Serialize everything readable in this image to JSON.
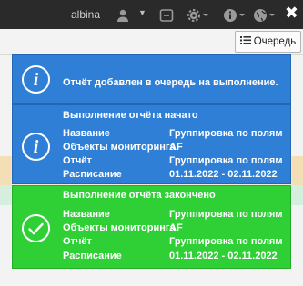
{
  "topbar": {
    "username": "albina",
    "icons": [
      "user-icon",
      "chevron-down-icon",
      "box-icon",
      "gear-icon",
      "info-icon",
      "globe-icon",
      "close-icon"
    ],
    "close_label": "✖"
  },
  "toolbar": {
    "queue_label": "Очередь",
    "queue_icon": "list-icon"
  },
  "notifications": [
    {
      "type": "info",
      "color": "#2f7fd6",
      "message": "Отчёт добавлен в очередь на выполнение."
    },
    {
      "type": "info",
      "color": "#2f7fd6",
      "title": "Выполнение отчёта начато",
      "rows": [
        {
          "label": "Название",
          "value": "Группировка по полям"
        },
        {
          "label": "Объекты мониторинга",
          "value": "AF"
        },
        {
          "label": "Отчёт",
          "value": "Группировка по полям"
        },
        {
          "label": "Расписание",
          "value": "01.11.2022 - 02.11.2022"
        }
      ]
    },
    {
      "type": "success",
      "color": "#2fcf36",
      "title": "Выполнение отчёта закончено",
      "rows": [
        {
          "label": "Название",
          "value": "Группировка по полям"
        },
        {
          "label": "Объекты мониторинга",
          "value": "AF"
        },
        {
          "label": "Отчёт",
          "value": "Группировка по полям"
        },
        {
          "label": "Расписание",
          "value": "01.11.2022 - 02.11.2022"
        }
      ]
    }
  ]
}
